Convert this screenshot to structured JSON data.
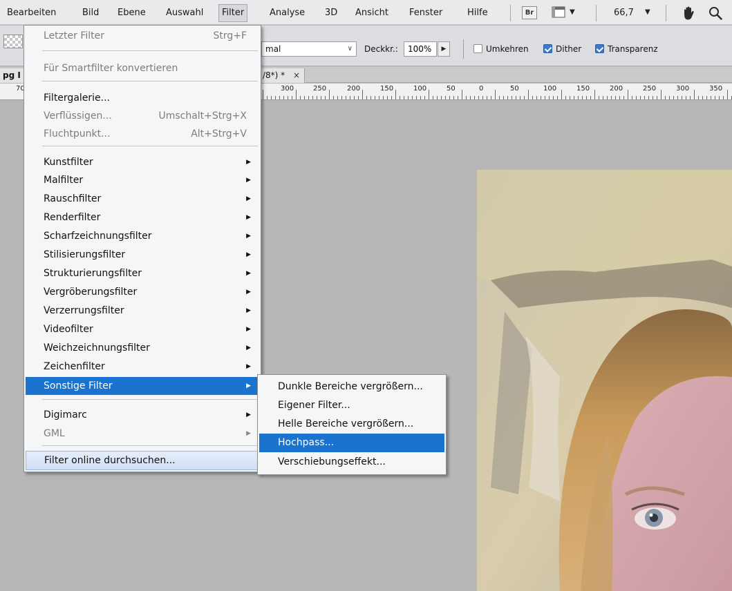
{
  "menubar": {
    "items": [
      "Bearbeiten",
      "Bild",
      "Ebene",
      "Auswahl",
      "Filter",
      "Analyse",
      "3D",
      "Ansicht",
      "Fenster",
      "Hilfe"
    ],
    "bridge_label": "Br",
    "zoom": "66,7"
  },
  "options": {
    "mode_value": "mal",
    "opacity_label": "Deckkr.:",
    "opacity_value": "100%",
    "checkboxes": [
      {
        "label": "Umkehren",
        "checked": false
      },
      {
        "label": "Dither",
        "checked": true
      },
      {
        "label": "Transparenz",
        "checked": true
      }
    ]
  },
  "document": {
    "tab_left": "pg I",
    "tab_right": "/8*) *",
    "close_glyph": "×",
    "ruler_labels": [
      "70",
      "300",
      "250",
      "200",
      "150",
      "100",
      "50",
      "0",
      "50",
      "100",
      "150",
      "200",
      "250",
      "300",
      "350"
    ]
  },
  "filter_menu": {
    "items": [
      {
        "label": "Letzter Filter",
        "shortcut": "Strg+F",
        "disabled": true
      },
      {
        "label": "Für Smartfilter konvertieren",
        "disabled": true
      },
      {
        "label": "Filtergalerie...",
        "disabled": false
      },
      {
        "label": "Verflüssigen...",
        "shortcut": "Umschalt+Strg+X",
        "disabled": true
      },
      {
        "label": "Fluchtpunkt...",
        "shortcut": "Alt+Strg+V",
        "disabled": true
      },
      {
        "label": "Kunstfilter",
        "submenu": true
      },
      {
        "label": "Malfilter",
        "submenu": true
      },
      {
        "label": "Rauschfilter",
        "submenu": true
      },
      {
        "label": "Renderfilter",
        "submenu": true
      },
      {
        "label": "Scharfzeichnungsfilter",
        "submenu": true
      },
      {
        "label": "Stilisierungsfilter",
        "submenu": true
      },
      {
        "label": "Strukturierungsfilter",
        "submenu": true
      },
      {
        "label": "Vergröberungsfilter",
        "submenu": true
      },
      {
        "label": "Verzerrungsfilter",
        "submenu": true
      },
      {
        "label": "Videofilter",
        "submenu": true
      },
      {
        "label": "Weichzeichnungsfilter",
        "submenu": true
      },
      {
        "label": "Zeichenfilter",
        "submenu": true
      },
      {
        "label": "Sonstige Filter",
        "submenu": true,
        "highlighted": true
      },
      {
        "label": "Digimarc",
        "submenu": true
      },
      {
        "label": "GML",
        "submenu": true,
        "disabled": true
      },
      {
        "label": "Filter online durchsuchen..."
      }
    ]
  },
  "sub_menu": {
    "items": [
      {
        "label": "Dunkle Bereiche vergrößern..."
      },
      {
        "label": "Eigener Filter..."
      },
      {
        "label": "Helle Bereiche vergrößern..."
      },
      {
        "label": "Hochpass...",
        "highlighted": true
      },
      {
        "label": "Verschiebungseffekt..."
      }
    ]
  },
  "colors": {
    "highlight": "#1a73cf",
    "menu_bg": "#f5f6f7",
    "canvas_bg": "#b7b7b7"
  }
}
